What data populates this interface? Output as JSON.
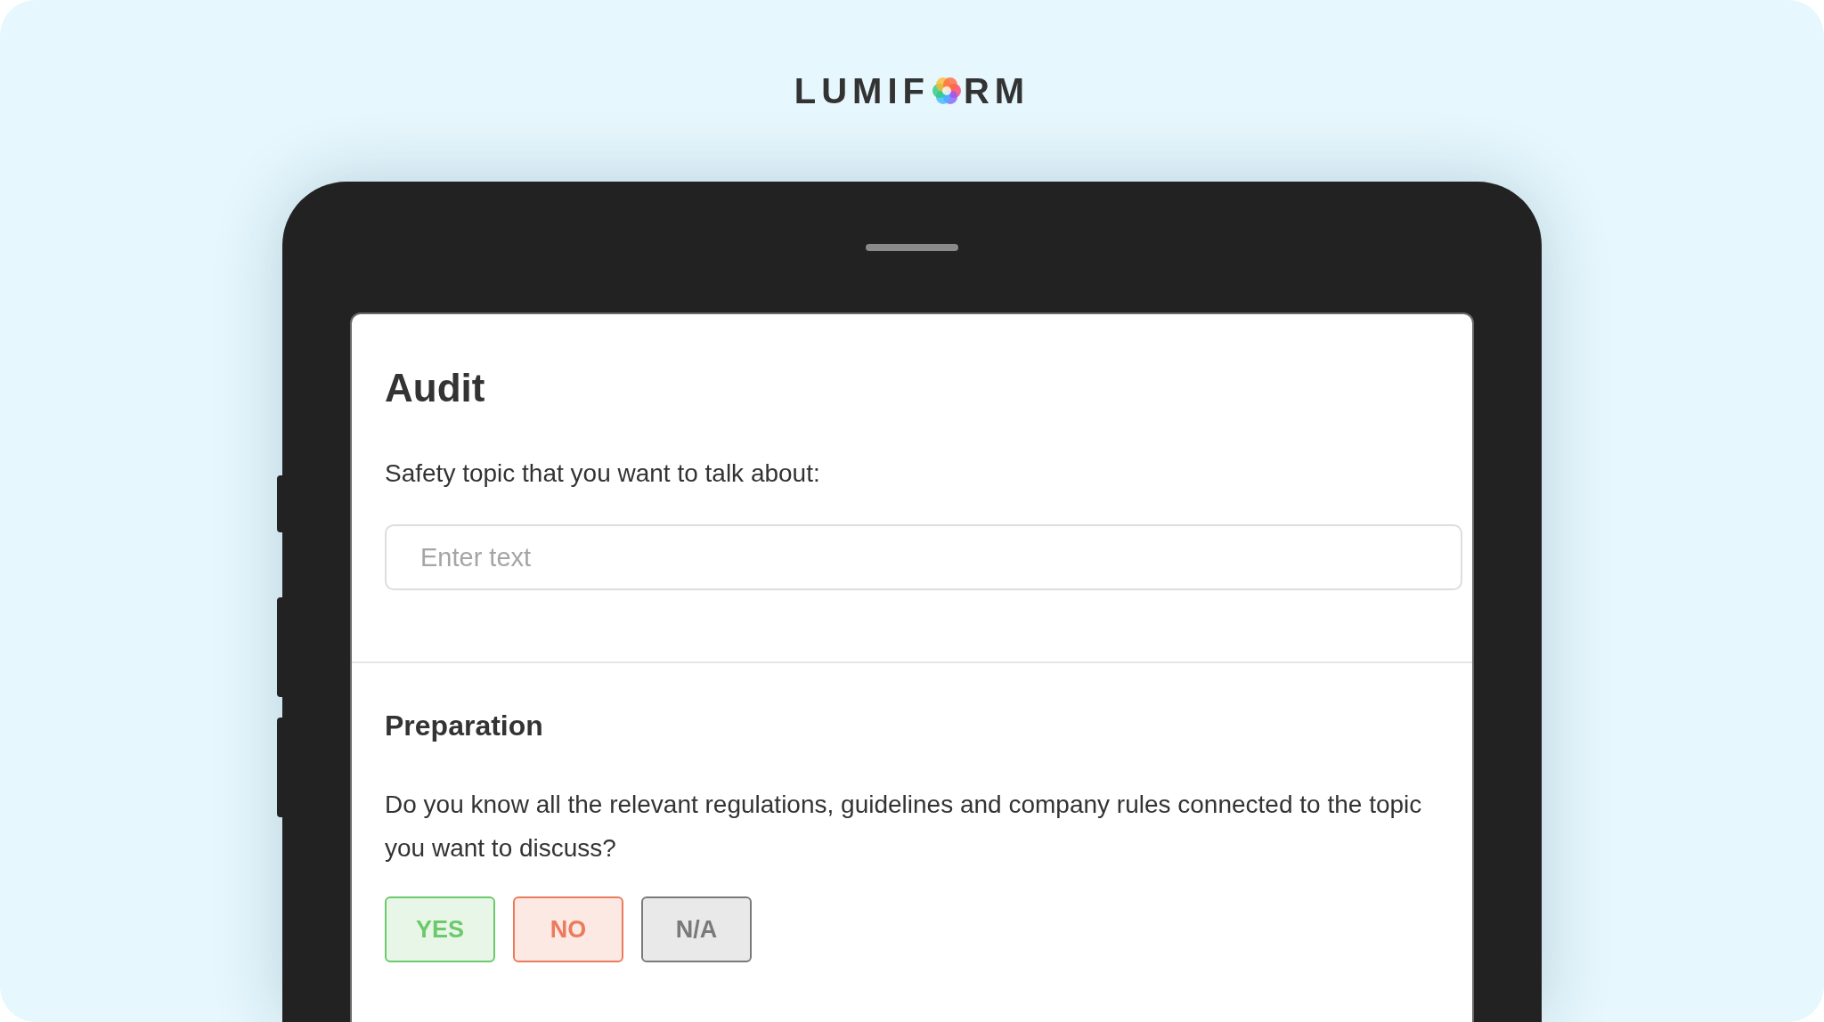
{
  "logo": {
    "left": "LUMIF",
    "right": "RM"
  },
  "form": {
    "title": "Audit",
    "field": {
      "label": "Safety topic that you want to talk about:",
      "placeholder": "Enter text"
    },
    "section": {
      "title": "Preparation",
      "question": "Do you know all the relevant regulations, guidelines and company rules connected to the topic you want to discuss?",
      "answers": [
        {
          "label": "YES",
          "color": "#6cc96c"
        },
        {
          "label": "NO",
          "color": "#ec7a5c"
        },
        {
          "label": "N/A",
          "color": "#7a7a7a"
        }
      ]
    }
  }
}
